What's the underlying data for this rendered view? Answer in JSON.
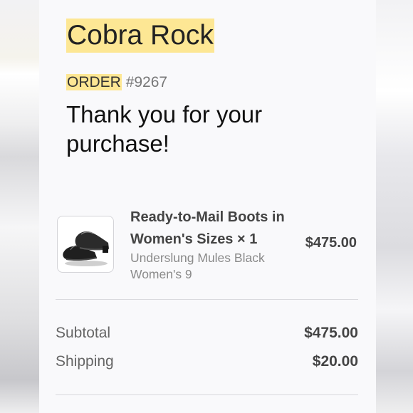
{
  "store": {
    "name": "Cobra Rock"
  },
  "order": {
    "label": "ORDER",
    "number": "#9267"
  },
  "message": "Thank you for your purchase!",
  "item": {
    "title": "Ready-to-Mail Boots in Women's Sizes × 1",
    "variant": "Underslung Mules Black Women's 9",
    "price": "$475.00",
    "image_icon": "black-leather-mules-icon"
  },
  "summary": {
    "subtotal_label": "Subtotal",
    "subtotal_value": "$475.00",
    "shipping_label": "Shipping",
    "shipping_value": "$20.00"
  },
  "colors": {
    "highlight": "#fde794",
    "panel": "#f9f9fb"
  }
}
